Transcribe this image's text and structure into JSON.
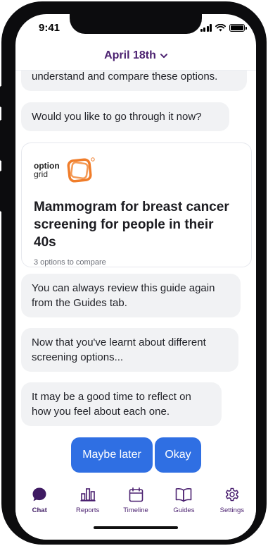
{
  "status_bar": {
    "time": "9:41",
    "icons": [
      "cellular-signal-icon",
      "wifi-icon",
      "battery-icon"
    ]
  },
  "header": {
    "title": "April 18th",
    "dropdown_icon": "chevron-down-icon"
  },
  "chat": {
    "messages": [
      "understand and compare these options.",
      "Would you like to go through it now?",
      "You can always review this guide again from the Guides tab.",
      "Now that you've learnt about different screening options...",
      "It may be a good time to reflect on how you feel about each one."
    ],
    "guide_card": {
      "brand_line1": "option",
      "brand_line2": "grid",
      "title": "Mammogram for breast cancer screening for people in their 40s",
      "subtitle": "3 options to compare"
    }
  },
  "actions": {
    "maybe_later": "Maybe later",
    "okay": "Okay"
  },
  "tab_bar": {
    "active": "Chat",
    "items": [
      {
        "label": "Chat",
        "icon": "chat-bubble-icon"
      },
      {
        "label": "Reports",
        "icon": "bar-chart-icon"
      },
      {
        "label": "Timeline",
        "icon": "calendar-icon"
      },
      {
        "label": "Guides",
        "icon": "book-icon"
      },
      {
        "label": "Settings",
        "icon": "gear-icon"
      }
    ]
  },
  "colors": {
    "accent_purple": "#4b2170",
    "button_blue": "#2f6fe3",
    "bubble_gray": "#f1f2f4",
    "brand_orange": "#f07d2a"
  }
}
